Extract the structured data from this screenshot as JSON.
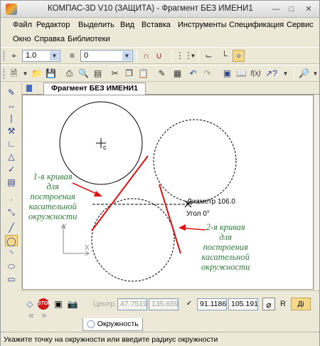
{
  "app": {
    "title": "КОМПАС-3D V10 (ЗАЩИТА) - Фрагмент БЕЗ ИМЕНИ1"
  },
  "menu": {
    "row1": [
      "Файл",
      "Редактор",
      "Выделить",
      "Вид",
      "Вставка",
      "Инструменты",
      "Спецификация",
      "Сервис"
    ],
    "row2": [
      "Окно",
      "Справка",
      "Библиотеки"
    ]
  },
  "toolbar1": {
    "line_scale": "1.0",
    "layer": "0"
  },
  "document": {
    "tab_label": "Фрагмент БЕЗ ИМЕНИ1"
  },
  "drawing": {
    "center_marker": "c",
    "x_axis_label": "X",
    "y_axis_label": "Y",
    "diameter_label": "Диаметр 106.0",
    "angle_label": "Угол 0°",
    "note1": [
      "1-я кривая",
      "для",
      "построения",
      "касательной",
      "окружности"
    ],
    "note2": [
      "2-я кривая",
      "для",
      "построения",
      "касательной",
      "окружности"
    ],
    "colors": {
      "curve": "#e01010",
      "note_text": "#2f7d3a",
      "geometry": "#000000"
    }
  },
  "properties": {
    "center_label": "Центр",
    "center_x": "47.7519",
    "center_y": "135.659",
    "point_x": "91.1186",
    "point_y": "105.191",
    "r_label": "R",
    "d_label": "Ді"
  },
  "object_tab": {
    "label": "Окружность"
  },
  "status": {
    "text": "Укажите точку на окружности или введите радиус окружности"
  }
}
